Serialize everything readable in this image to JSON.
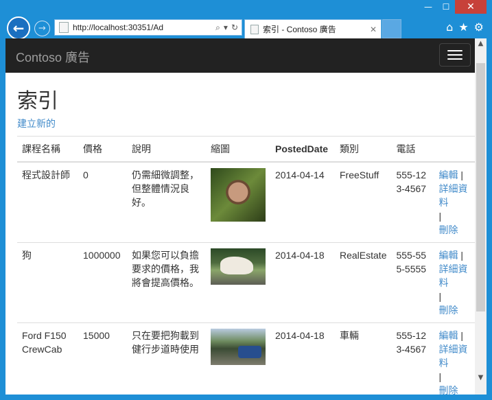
{
  "browser": {
    "address": "http://localhost:30351/Ad",
    "tab_title": "索引 - Contoso 廣告",
    "tab_close": "✕",
    "minimize": "—",
    "maximize": "☐",
    "close": "✕"
  },
  "navbar": {
    "brand": "Contoso 廣告"
  },
  "page": {
    "title": "索引",
    "create_link": "建立新的"
  },
  "table": {
    "headers": [
      "課程名稱",
      "價格",
      "說明",
      "縮圖",
      "PostedDate",
      "類別",
      "電話",
      ""
    ],
    "rows": [
      {
        "title": "程式設計師",
        "price": "0",
        "description": "仍需細微調整，但整體情況良好。",
        "posted": "2014-04-14",
        "category": "FreeStuff",
        "phone": "555-123-4567",
        "edit": "編輯",
        "details": "詳細資料",
        "delete": "刪除",
        "sep1": " |",
        "sep2": "|"
      },
      {
        "title": "狗",
        "price": "1000000",
        "description": "如果您可以負擔要求的價格，我將會提高價格。",
        "posted": "2014-04-18",
        "category": "RealEstate",
        "phone": "555-555-5555",
        "edit": "編輯",
        "details": "詳細資料",
        "delete": "刪除",
        "sep1": " |",
        "sep2": "|"
      },
      {
        "title": "Ford F150 CrewCab",
        "price": "15000",
        "description": "只在要把狗載到健行步道時使用",
        "posted": "2014-04-18",
        "category": "車輛",
        "phone": "555-123-4567",
        "edit": "編輯",
        "details": "詳細資料",
        "delete": "刪除",
        "sep1": " |",
        "sep2": "|"
      }
    ]
  }
}
